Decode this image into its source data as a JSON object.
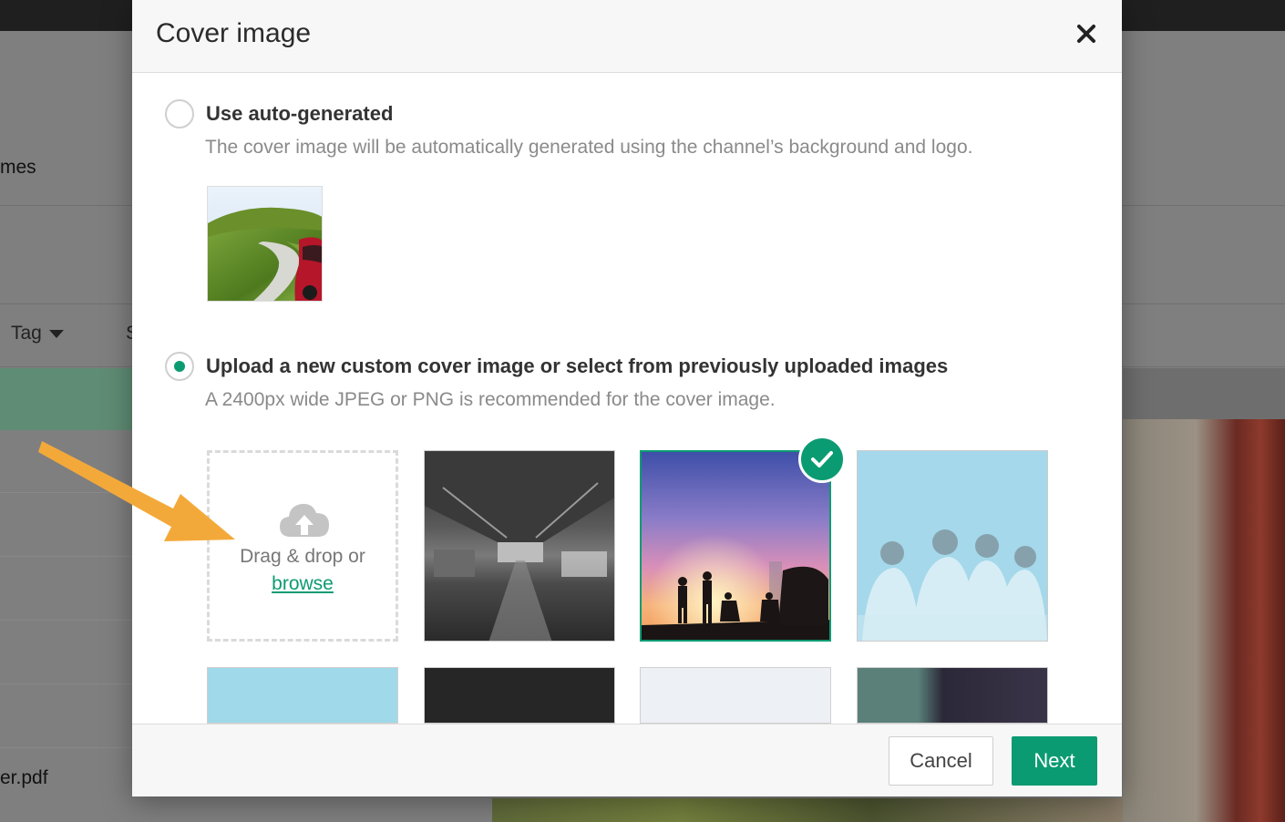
{
  "modal": {
    "title": "Cover image",
    "close_icon": "close-icon"
  },
  "auto_option": {
    "label": "Use auto-generated",
    "description": "The cover image will be automatically generated using the channel’s background and logo.",
    "selected": false
  },
  "custom_option": {
    "label": "Upload a new custom cover image or select from previously uploaded images",
    "description": "A 2400px wide JPEG or PNG is recommended for the cover image.",
    "selected": true
  },
  "dropzone": {
    "text": "Drag & drop or",
    "link": "browse",
    "icon": "cloud-upload-icon"
  },
  "footer": {
    "cancel_label": "Cancel",
    "next_label": "Next"
  },
  "background": {
    "fragment_names": "mes",
    "tag_filter": "Tag",
    "fragment_s": "S",
    "fragment_file": "er.pdf"
  },
  "colors": {
    "accent": "#0b9b72",
    "annotation_arrow": "#f3a93a"
  }
}
